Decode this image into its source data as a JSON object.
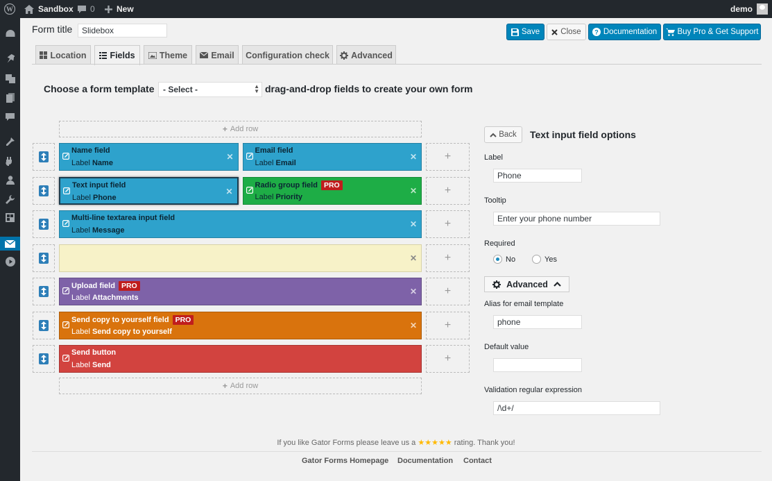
{
  "admin_bar": {
    "site_name": "Sandbox",
    "comments_count": "0",
    "new_label": "New",
    "user": "demo"
  },
  "header": {
    "form_title_label": "Form title",
    "form_title_value": "Slidebox",
    "buttons": {
      "save": "Save",
      "close": "Close",
      "documentation": "Documentation",
      "buy_pro": "Buy Pro & Get Support"
    }
  },
  "tabs": [
    "Location",
    "Fields",
    "Theme",
    "Email",
    "Configuration check",
    "Advanced"
  ],
  "active_tab": "Fields",
  "template": {
    "prefix": "Choose a form template",
    "select_value": "- Select -",
    "suffix": "drag-and-drop fields to create your own form"
  },
  "builder": {
    "add_row": "Add row",
    "label_prefix": "Label",
    "pro_badge": "PRO",
    "rows": [
      [
        {
          "name": "Name field",
          "label": "Name",
          "color": "#2ea2cc"
        },
        {
          "name": "Email field",
          "label": "Email",
          "color": "#2ea2cc"
        }
      ],
      [
        {
          "name": "Text input field",
          "label": "Phone",
          "color": "#2ea2cc",
          "selected": true
        },
        {
          "name": "Radio group field",
          "label": "Priority",
          "color": "#1ead46",
          "pro": true
        }
      ],
      [
        {
          "name": "Multi-line textarea input field",
          "label": "Message",
          "color": "#2ea2cc"
        }
      ],
      [
        {
          "name": "",
          "label": "",
          "color": "#f7f2c8"
        }
      ],
      [
        {
          "name": "Upload field",
          "label": "Attachments",
          "color": "#7e62a8",
          "pro": true
        }
      ],
      [
        {
          "name": "Send copy to yourself field",
          "label": "Send copy to yourself",
          "color": "#d9730d",
          "pro": true
        }
      ],
      [
        {
          "name": "Send button",
          "label": "Send",
          "color": "#d2433f"
        }
      ]
    ]
  },
  "options": {
    "back": "Back",
    "title": "Text input field options",
    "label_label": "Label",
    "label_value": "Phone",
    "tooltip_label": "Tooltip",
    "tooltip_value": "Enter your phone number",
    "required_label": "Required",
    "required_no": "No",
    "required_yes": "Yes",
    "required_selected": "No",
    "advanced": "Advanced",
    "alias_label": "Alias for email template",
    "alias_value": "phone",
    "default_label": "Default value",
    "default_value": "",
    "regex_label": "Validation regular expression",
    "regex_value": "/\\d+/"
  },
  "footer": {
    "note_before": "If you like Gator Forms please leave us a",
    "stars": "★★★★★",
    "note_after": "rating. Thank you!",
    "links": [
      "Gator Forms Homepage",
      "Documentation",
      "Contact"
    ]
  }
}
